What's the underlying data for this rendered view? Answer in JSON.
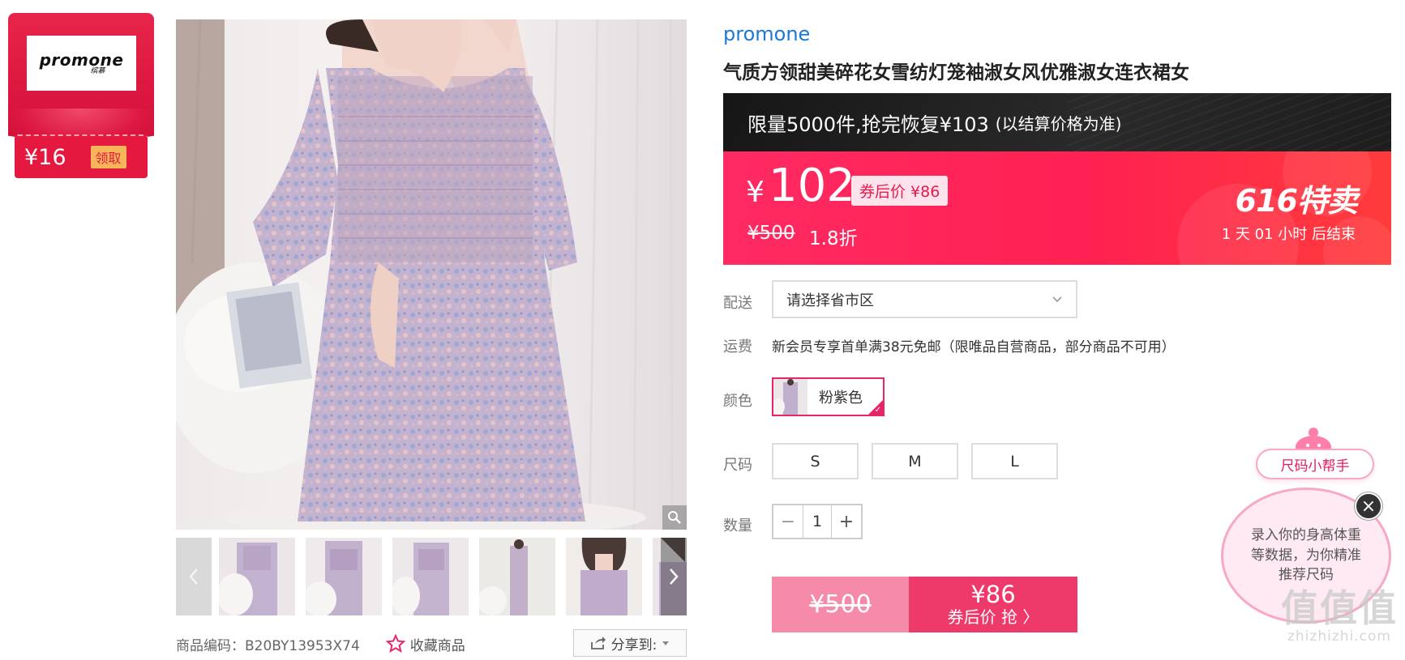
{
  "brand_card": {
    "logo_text": "promone",
    "logo_subtext": "缤慕",
    "coupon_amount": "¥16",
    "claim_label": "领取"
  },
  "gallery": {
    "thumbnails": [
      "dress-front",
      "dress-front-2",
      "dress-front-3",
      "dress-full",
      "dress-closeup",
      "dress-side"
    ]
  },
  "footer": {
    "sku": "商品编码：B20BY13953X74",
    "favorite_label": "收藏商品",
    "share_label": "分享到:"
  },
  "product": {
    "brand": "promone",
    "title": "气质方领甜美碎花女雪纺灯笼袖淑女风优雅淑女连衣裙女"
  },
  "limit_banner": {
    "main": "限量5000件,抢完恢复¥103",
    "sub": "(以结算价格为准)"
  },
  "price": {
    "currency": "¥",
    "value": "102",
    "after_coupon": "券后价 ¥86",
    "original": "¥500",
    "discount": "1.8折",
    "promo_label": "616特卖",
    "countdown": "1  天 01  小时 后结束"
  },
  "delivery": {
    "label": "配送",
    "placeholder": "请选择省市区"
  },
  "shipping": {
    "label": "运费",
    "text": "新会员专享首单满38元免邮（限唯品自营商品，部分商品不可用）"
  },
  "color": {
    "label": "颜色",
    "selected": "粉紫色"
  },
  "size": {
    "label": "尺码",
    "options": [
      "S",
      "M",
      "L"
    ]
  },
  "quantity": {
    "label": "数量",
    "value": "1",
    "minus": "−",
    "plus": "+"
  },
  "buy": {
    "original": "¥500",
    "price": "¥86",
    "cta": "券后价 抢 〉"
  },
  "size_helper": {
    "title": "尺码小帮手",
    "message": "录入你的身高体重等数据，为你精准推荐尺码",
    "close": "×"
  },
  "watermark": {
    "main": "值值值",
    "sub": "zhizhizhi.com"
  },
  "colors": {
    "accent_pink": "#ff2151",
    "brand_blue": "#1a79d8",
    "coupon_red": "#e5193f"
  }
}
